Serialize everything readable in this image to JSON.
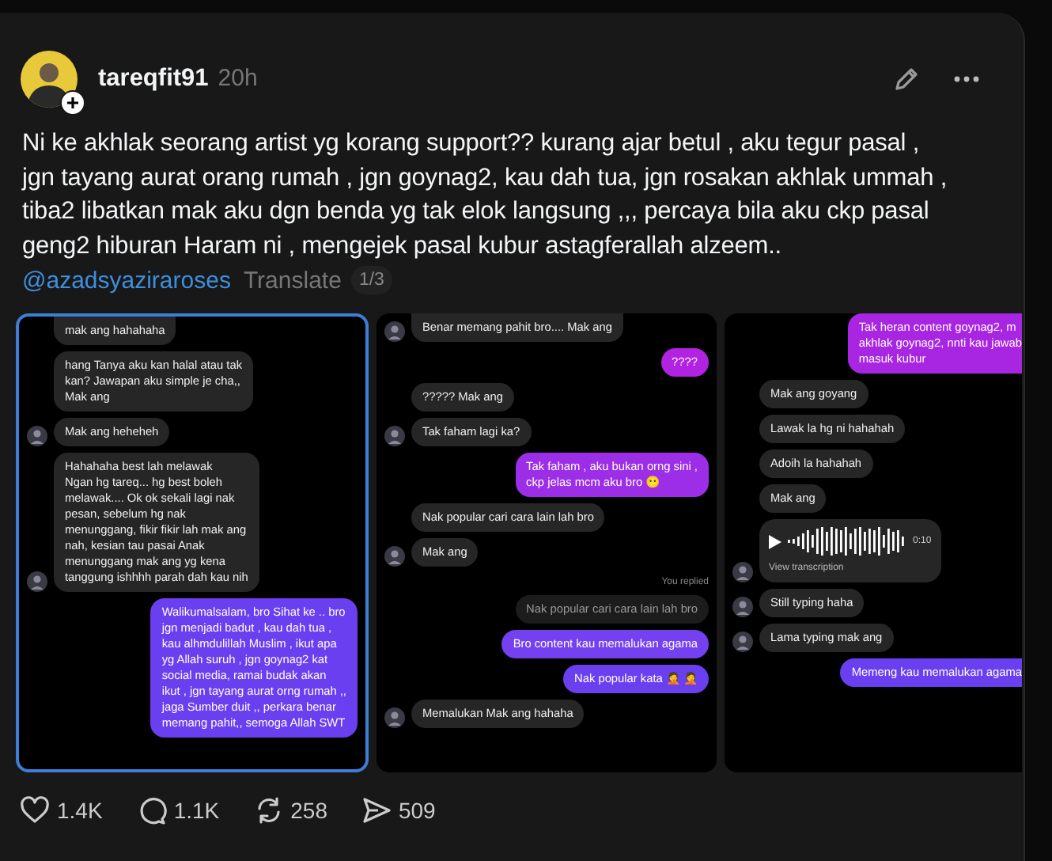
{
  "post": {
    "username": "tareqfit91",
    "time": "20h",
    "text_lines": [
      "Ni ke akhlak seorang artist yg korang support?? kurang ajar betul , aku tegur pasal ,",
      "jgn tayang aurat orang rumah , jgn goynag2, kau dah tua, jgn rosakan akhlak ummah ,",
      "tiba2 libatkan mak aku dgn benda yg tak elok langsung ,,, percaya bila aku ckp pasal",
      "geng2 hiburan Haram ni , mengejek pasal kubur astagferallah alzeem.."
    ],
    "mention": "@azadsyaziraroses",
    "translate": "Translate",
    "page_count": "1/3"
  },
  "screenshots": [
    {
      "selected": true,
      "cut_right": false,
      "messages": [
        {
          "kind": "in",
          "avatar": false,
          "lines": [
            "mak ang hahahaha"
          ]
        },
        {
          "kind": "in",
          "avatar": false,
          "lines": [
            "hang Tanya aku kan halal atau tak",
            "kan? Jawapan aku simple je cha,,",
            "Mak ang"
          ]
        },
        {
          "kind": "in",
          "avatar": true,
          "lines": [
            "Mak ang heheheh"
          ]
        },
        {
          "kind": "in",
          "avatar": true,
          "lines": [
            "Hahahaha best lah melawak",
            "Ngan hg tareq... hg best boleh",
            "melawak.... Ok ok sekali lagi nak",
            "pesan, sebelum hg nak",
            "menunggang, fikir fikir lah mak ang",
            "nah, kesian tau pasai Anak",
            "menunggang mak ang yg kena",
            "tanggung ishhhh parah dah kau nih"
          ]
        },
        {
          "kind": "out",
          "color": "#6a3ff0",
          "lines": [
            "Walikumalsalam, bro Sihat ke .. bro",
            "jgn menjadi badut , kau dah tua ,",
            "kau alhmdulillah Muslim , ikut apa",
            "yg Allah suruh , jgn goynag2 kat",
            "social media, ramai budak akan",
            "ikut , jgn tayang aurat orng rumah ,,",
            "jaga Sumber duit ,, perkara benar",
            "memang pahit,, semoga Allah SWT"
          ]
        }
      ]
    },
    {
      "selected": false,
      "cut_right": false,
      "messages": [
        {
          "kind": "in",
          "avatar": true,
          "lines": [
            "Benar memang pahit bro.... Mak ang"
          ]
        },
        {
          "kind": "out",
          "color": "#b123e0",
          "lines": [
            "????"
          ]
        },
        {
          "kind": "in",
          "avatar": false,
          "lines": [
            "????? Mak ang"
          ]
        },
        {
          "kind": "in",
          "avatar": true,
          "lines": [
            "Tak faham lagi ka?"
          ]
        },
        {
          "kind": "out",
          "color": "#9b2ee6",
          "lines": [
            "Tak faham , aku bukan orng sini ,",
            "ckp jelas mcm aku bro 😶"
          ]
        },
        {
          "kind": "in",
          "avatar": false,
          "lines": [
            "Nak popular cari cara lain lah bro"
          ]
        },
        {
          "kind": "in",
          "avatar": true,
          "lines": [
            "Mak ang"
          ]
        },
        {
          "kind": "label",
          "lines": [
            "You replied"
          ]
        },
        {
          "kind": "quoted",
          "lines": [
            "Nak popular cari cara lain lah bro"
          ]
        },
        {
          "kind": "out",
          "color": "#7440f0",
          "lines": [
            "Bro content kau memalukan agama"
          ]
        },
        {
          "kind": "out",
          "color": "#6a3ff0",
          "lines": [
            "Nak popular kata 🤦 🤦"
          ]
        },
        {
          "kind": "in",
          "avatar": true,
          "lines": [
            "Memalukan Mak ang hahaha"
          ]
        }
      ]
    },
    {
      "selected": false,
      "cut_right": true,
      "messages": [
        {
          "kind": "out",
          "color": "#a826e2",
          "lines": [
            "Tak heran content goynag2, m",
            "akhlak goynag2, nnti kau jawab",
            "masuk kubur"
          ]
        },
        {
          "kind": "in",
          "avatar": false,
          "lines": [
            "Mak ang goyang"
          ]
        },
        {
          "kind": "in",
          "avatar": false,
          "lines": [
            "Lawak la hg ni hahahah"
          ]
        },
        {
          "kind": "in",
          "avatar": false,
          "lines": [
            "Adoih la hahahah"
          ]
        },
        {
          "kind": "in",
          "avatar": false,
          "lines": [
            "Mak ang"
          ]
        },
        {
          "kind": "voice",
          "avatar": true,
          "duration": "0:10",
          "link": "View transcription"
        },
        {
          "kind": "in",
          "avatar": true,
          "lines": [
            "Still typing haha"
          ]
        },
        {
          "kind": "in",
          "avatar": true,
          "lines": [
            "Lama typing mak ang"
          ]
        },
        {
          "kind": "out",
          "color": "#6a3ff0",
          "lines": [
            "Memeng kau memalukan agama"
          ]
        }
      ]
    }
  ],
  "actions": [
    {
      "kind": "like",
      "count": "1.4K"
    },
    {
      "kind": "comment",
      "count": "1.1K"
    },
    {
      "kind": "repost",
      "count": "258"
    },
    {
      "kind": "share",
      "count": "509"
    }
  ]
}
